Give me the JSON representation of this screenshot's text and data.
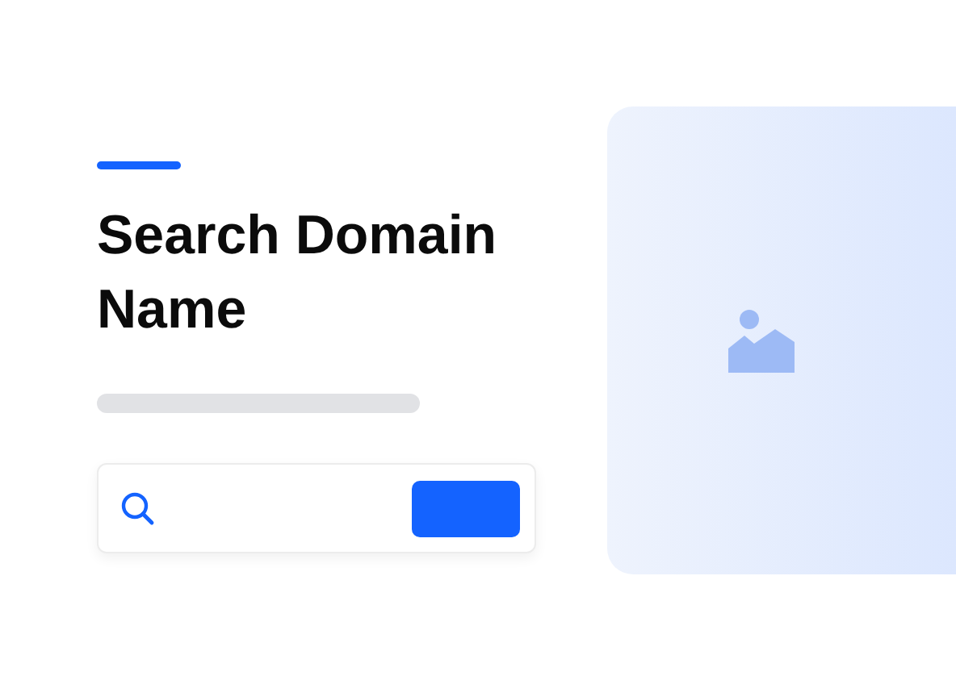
{
  "heading": {
    "title": "Search Domain Name"
  }
}
